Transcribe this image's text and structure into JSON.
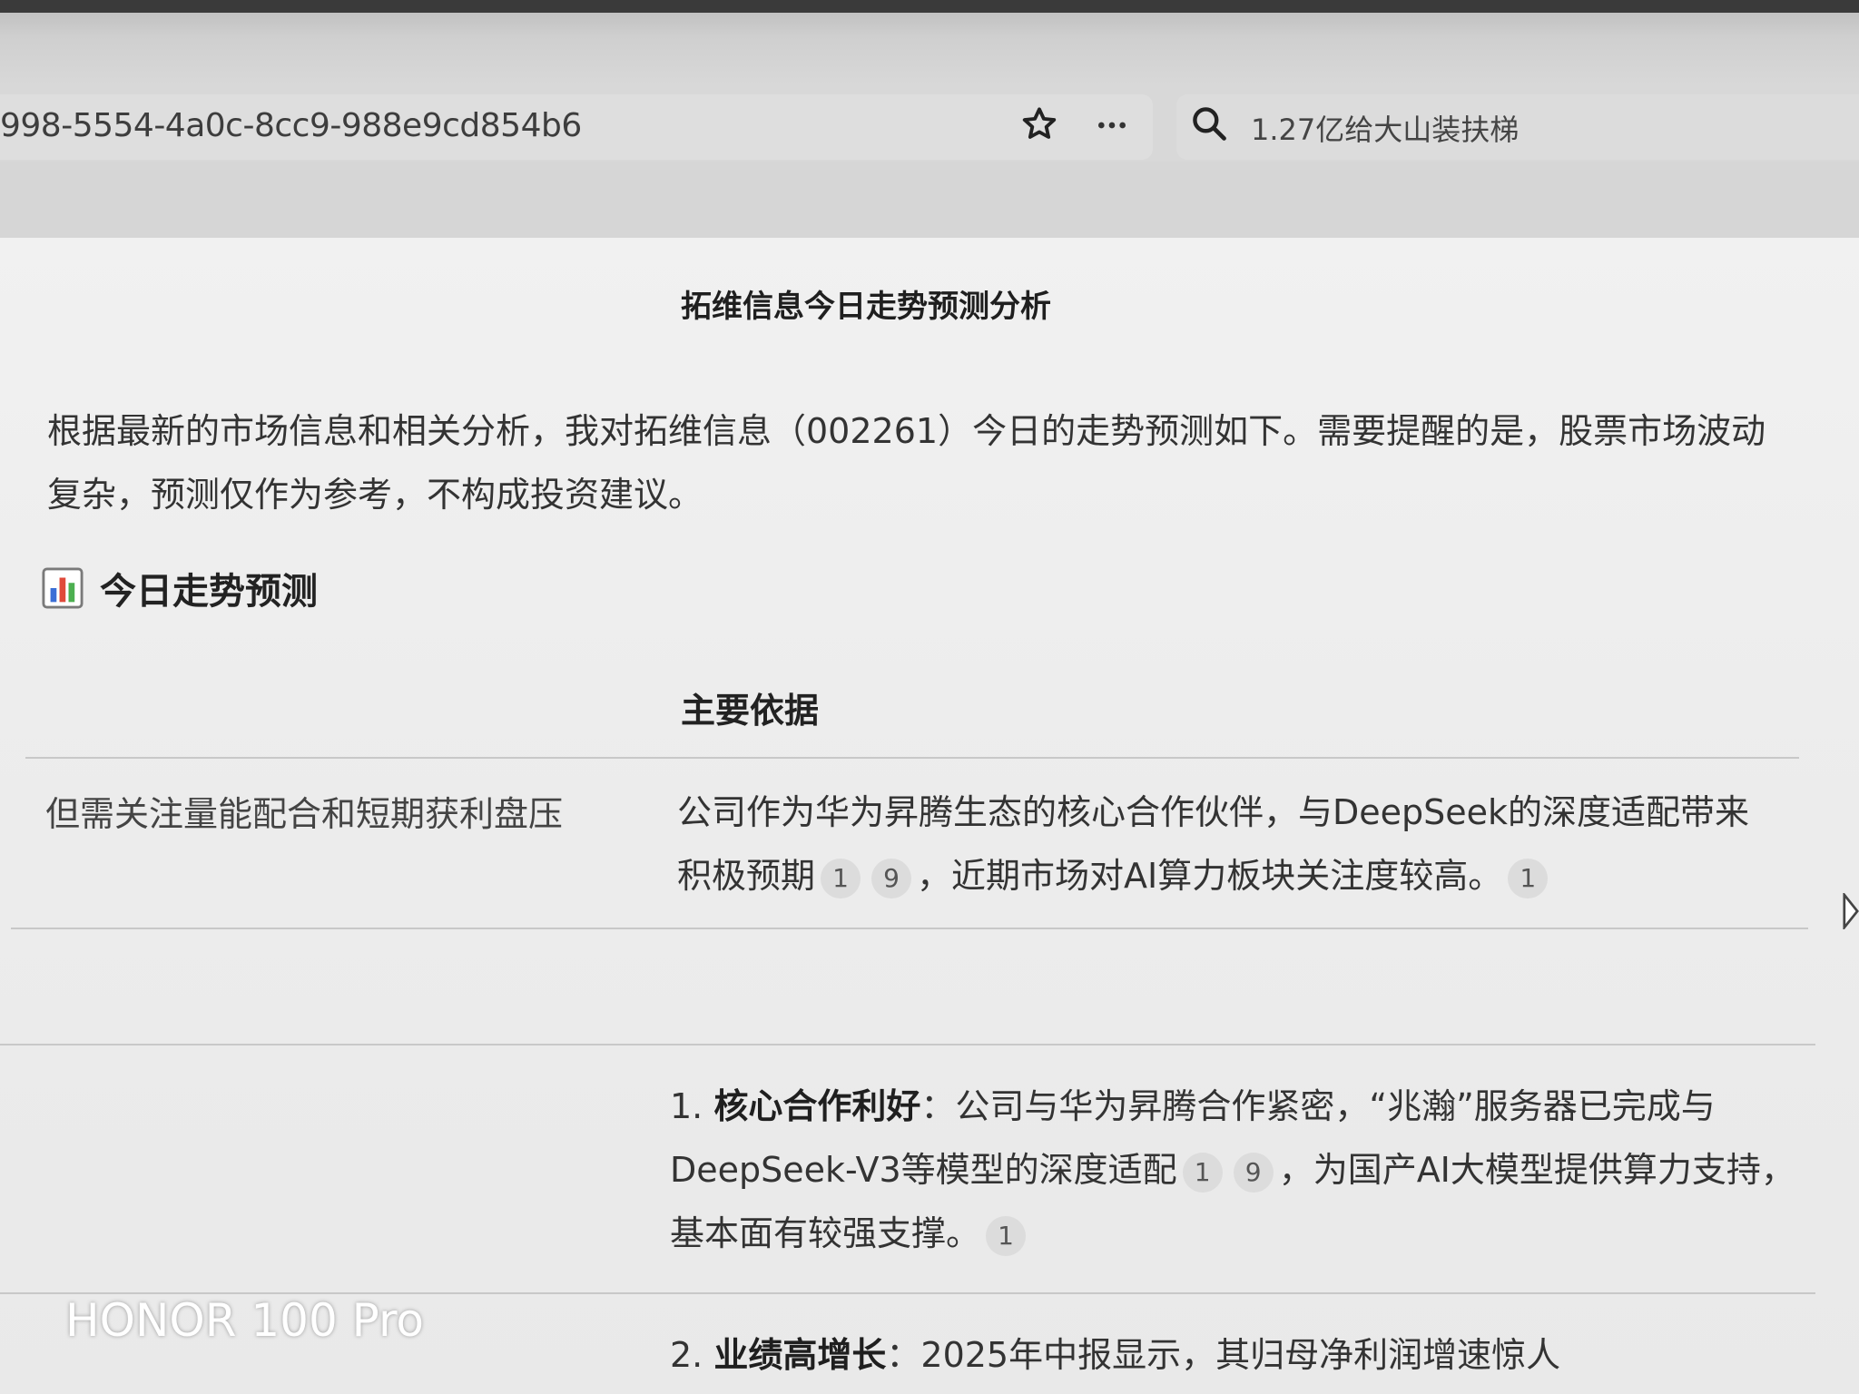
{
  "browser": {
    "url": "998-5554-4a0c-8cc9-988e9cd854b6",
    "search_text": "1.27亿给大山装扶梯",
    "icons": [
      "star-icon",
      "more-icon",
      "search-icon"
    ]
  },
  "page": {
    "title": "拓维信息今日走势预测分析",
    "intro": "根据最新的市场信息和相关分析，我对拓维信息（002261）今日的走势预测如下。需要提醒的是，股票市场波动复杂，预测仅作为参考，不构成投资建议。",
    "section_heading": "今日走势预测",
    "table": {
      "column_header": "主要依据",
      "row1_left": "但需关注量能配合和短期获利盘压",
      "row1_right_a": "公司作为华为昇腾生态的核心合作伙伴，与DeepSeek的深度适配带来积极预期",
      "row1_right_b": "，近期市场对AI算力板块关注度较高。",
      "citations": [
        "1",
        "9",
        "1"
      ]
    },
    "items": [
      {
        "number": "1.",
        "title": "核心合作利好",
        "colon": "：",
        "text_a": "公司与华为昇腾合作紧密，“兆瀚”服务器已完成与DeepSeek-V3等模型的深度适配",
        "text_b": "，为国产AI大模型提供算力支持，基本面有较强支撑。",
        "citations": [
          "1",
          "9",
          "1"
        ]
      },
      {
        "number": "2.",
        "title": "业绩高增长",
        "colon": "：",
        "text_a": "2025年中报显示，其归母净利润增速惊人"
      }
    ]
  },
  "watermark": "HONOR 100 Pro"
}
